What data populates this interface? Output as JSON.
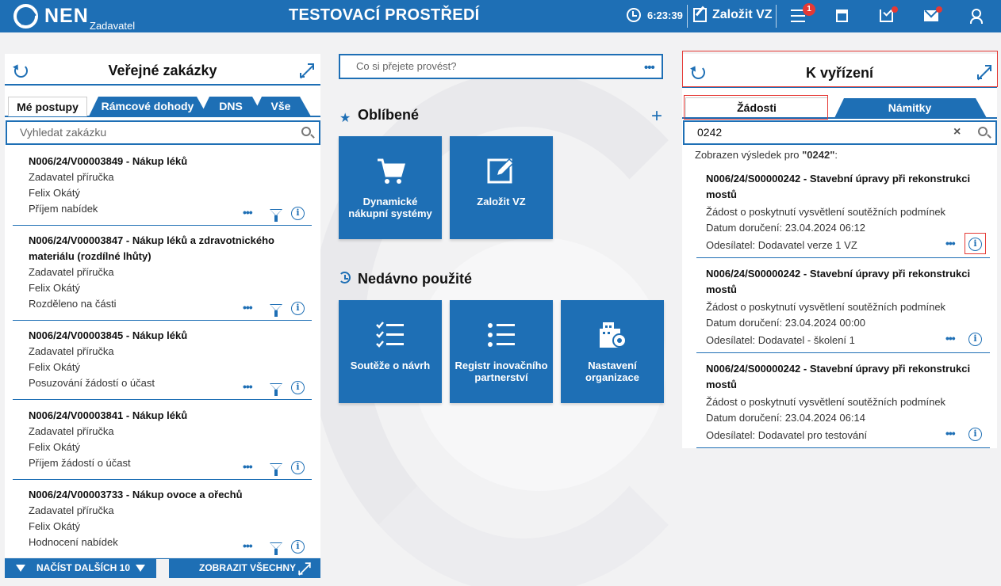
{
  "header": {
    "logo": "NEN",
    "role": "Zadavatel",
    "env_title": "TESTOVACÍ PROSTŘEDÍ",
    "time": "6:23:39",
    "new_vz": "Založit VZ",
    "menu_badge": "1"
  },
  "left": {
    "title": "Veřejné zakázky",
    "tabs": [
      "Mé postupy",
      "Rámcové dohody",
      "DNS",
      "Vše"
    ],
    "search_placeholder": "Vyhledat zakázku",
    "items": [
      {
        "title": "N006/24/V00003849 - Nákup léků",
        "lines": [
          "Zadavatel příručka",
          "Felix Okátý",
          "Příjem nabídek"
        ]
      },
      {
        "title": "N006/24/V00003847 - Nákup léků a zdravotnického materiálu (rozdílné lhůty)",
        "lines": [
          "Zadavatel příručka",
          "Felix Okátý",
          "Rozděleno na části"
        ]
      },
      {
        "title": "N006/24/V00003845 - Nákup léků",
        "lines": [
          "Zadavatel příručka",
          "Felix Okátý",
          "Posuzování žádostí o účast"
        ]
      },
      {
        "title": "N006/24/V00003841 - Nákup léků",
        "lines": [
          "Zadavatel příručka",
          "Felix Okátý",
          "Příjem žádostí o účast"
        ]
      },
      {
        "title": "N006/24/V00003733 - Nákup ovoce a ořechů",
        "lines": [
          "Zadavatel příručka",
          "Felix Okátý",
          "Hodnocení nabídek"
        ]
      }
    ],
    "load_more": "NAČÍST DALŠÍCH 10",
    "show_all": "ZOBRAZIT VŠECHNY"
  },
  "center": {
    "action_placeholder": "Co si přejete provést?",
    "favorites_title": "Oblíbené",
    "favorites": [
      "Dynamické nákupní systémy",
      "Založit VZ"
    ],
    "recent_title": "Nedávno použité",
    "recent": [
      "Soutěže o návrh",
      "Registr inovačního partnerství",
      "Nastavení organizace"
    ]
  },
  "right": {
    "title": "K vyřízení",
    "tabs": [
      "Žádosti",
      "Námitky"
    ],
    "search_value": "0242",
    "result_prefix": "Zobrazen výsledek pro ",
    "result_term": "\"0242\"",
    "result_suffix": ":",
    "items": [
      {
        "title": "N006/24/S00000242 - Stavební úpravy při rekonstrukci mostů",
        "type": "Žádost o poskytnutí vysvětlení soutěžních podmínek",
        "date": "Datum doručení: 23.04.2024 06:12",
        "sender": "Odesílatel: Dodavatel verze 1 VZ"
      },
      {
        "title": "N006/24/S00000242 - Stavební úpravy při rekonstrukci mostů",
        "type": "Žádost o poskytnutí vysvětlení soutěžních podmínek",
        "date": "Datum doručení: 23.04.2024 00:00",
        "sender": "Odesílatel: Dodavatel - školení 1"
      },
      {
        "title": "N006/24/S00000242 - Stavební úpravy při rekonstrukci mostů",
        "type": "Žádost o poskytnutí vysvětlení soutěžních podmínek",
        "date": "Datum doručení: 23.04.2024 06:14",
        "sender": "Odesílatel: Dodavatel pro testování"
      }
    ]
  },
  "colors": {
    "primary": "#1e6fb5",
    "highlight": "#e53935"
  },
  "icons": [
    "clock-icon",
    "edit-icon",
    "menu-icon",
    "calculator-icon",
    "inbox-icon",
    "mail-icon",
    "user-icon",
    "refresh-icon",
    "expand-icon",
    "search-icon",
    "more-icon",
    "filter-icon",
    "info-icon",
    "star-icon",
    "plus-icon",
    "history-icon",
    "cart-icon",
    "checklist-icon",
    "list-icon",
    "building-gear-icon",
    "clear-icon"
  ]
}
